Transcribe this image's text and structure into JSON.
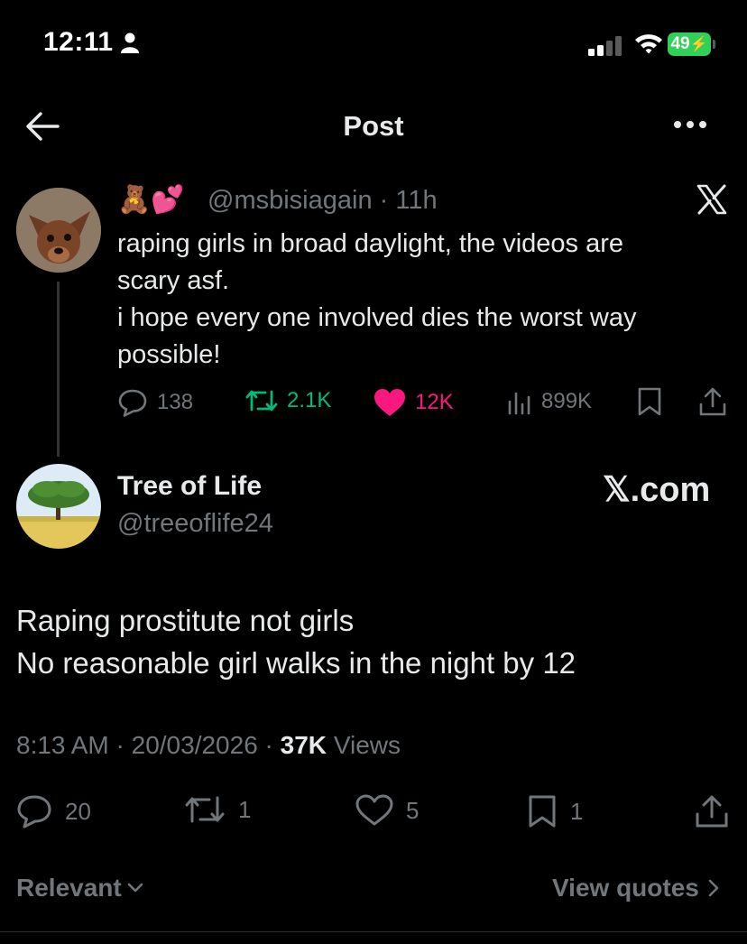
{
  "status_bar": {
    "time": "12:11",
    "battery": "49"
  },
  "header": {
    "title": "Post"
  },
  "quoted": {
    "emoji": "🧸💕",
    "handle": "@msbisiagain",
    "age": "11h",
    "text_lines": [
      "raping girls in broad daylight, the videos are",
      "scary asf.",
      "i hope every one involved dies the worst way",
      "possible!"
    ],
    "replies": "138",
    "reposts": "2.1K",
    "likes": "12K",
    "views": "899K",
    "colors": {
      "repost": "#00ba7c",
      "like": "#f91880",
      "muted": "#71767b"
    }
  },
  "main": {
    "name": "Tree of Life",
    "handle": "@treeoflife24",
    "watermark": "𝕏.com",
    "text_lines": [
      "Raping prostitute not girls",
      "No reasonable girl walks in the night by 12"
    ],
    "time": "8:13 AM",
    "date": "20/03/2026",
    "views_count": "37K",
    "views_label": "Views",
    "replies": "20",
    "reposts": "1",
    "likes": "5",
    "bookmarks": "1"
  },
  "footer": {
    "sort_label": "Relevant",
    "quotes_label": "View quotes"
  }
}
